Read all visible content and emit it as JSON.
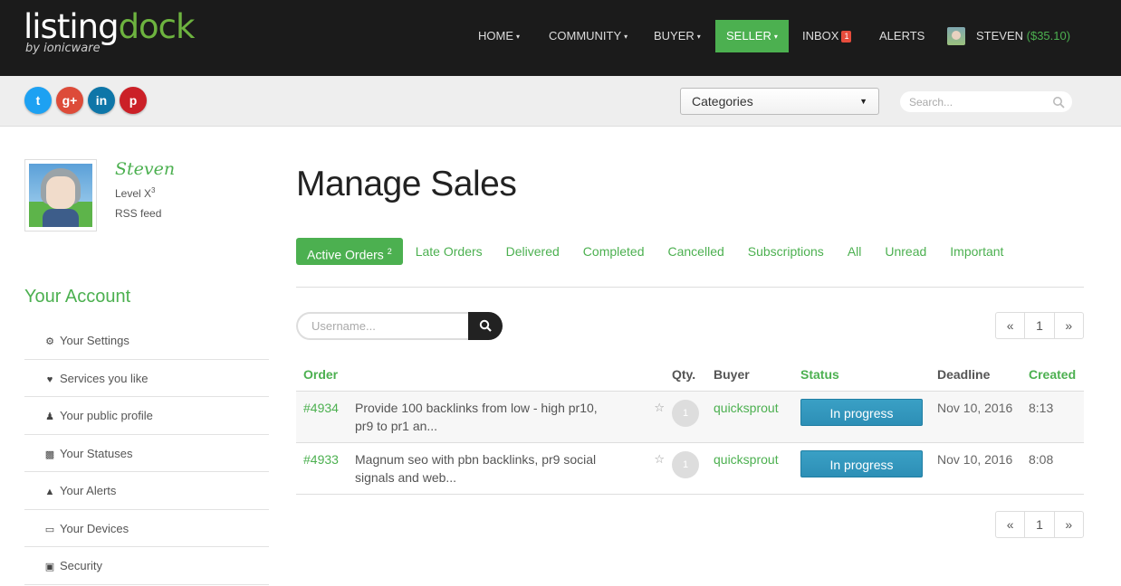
{
  "header": {
    "logo_main": "listing",
    "logo_accent": "dock",
    "logo_sub": "by ionicware",
    "nav": [
      {
        "label": "HOME",
        "caret": "▾"
      },
      {
        "label": "COMMUNITY",
        "caret": "▾"
      },
      {
        "label": "BUYER",
        "caret": "▾"
      },
      {
        "label": "SELLER",
        "caret": "▾"
      },
      {
        "label": "INBOX",
        "badge": "1"
      },
      {
        "label": "ALERTS"
      }
    ],
    "user": {
      "name": "STEVEN",
      "balance": "($35.10)"
    }
  },
  "secondary": {
    "social": {
      "twitter": "t",
      "google": "g+",
      "linkedin": "in",
      "pinterest": "p"
    },
    "categories_label": "Categories",
    "search_placeholder": "Search..."
  },
  "sidebar": {
    "username": "Steven",
    "level_text": "Level X",
    "level_sup": "3",
    "rss": "RSS feed",
    "account_title": "Your Account",
    "menu": [
      {
        "label": "Your Settings",
        "icon": "gears-icon"
      },
      {
        "label": "Services you like",
        "icon": "heart-icon"
      },
      {
        "label": "Your public profile",
        "icon": "user-icon"
      },
      {
        "label": "Your Statuses",
        "icon": "chart-icon"
      },
      {
        "label": "Your Alerts",
        "icon": "bell-icon"
      },
      {
        "label": "Your Devices",
        "icon": "monitor-icon"
      },
      {
        "label": "Security",
        "icon": "lock-icon"
      }
    ]
  },
  "main": {
    "title": "Manage Sales",
    "tabs": [
      {
        "label": "Active Orders",
        "count": "2"
      },
      {
        "label": "Late Orders"
      },
      {
        "label": "Delivered"
      },
      {
        "label": "Completed"
      },
      {
        "label": "Cancelled"
      },
      {
        "label": "Subscriptions"
      },
      {
        "label": "All"
      },
      {
        "label": "Unread"
      },
      {
        "label": "Important"
      }
    ],
    "filter_placeholder": "Username...",
    "pager": {
      "prev": "«",
      "page": "1",
      "next": "»"
    },
    "columns": {
      "order": "Order",
      "qty": "Qty.",
      "buyer": "Buyer",
      "status": "Status",
      "deadline": "Deadline",
      "created": "Created"
    },
    "orders": [
      {
        "id": "#4934",
        "desc_line1": "Provide 100 backlinks from low - high pr10,",
        "desc_line2": "pr9 to pr1 an...",
        "qty": "1",
        "buyer": "quicksprout",
        "status": "In progress",
        "deadline": "Nov 10, 2016",
        "created": "8:13"
      },
      {
        "id": "#4933",
        "desc_line1": "Magnum seo with pbn backlinks, pr9 social",
        "desc_line2": "signals and web...",
        "qty": "1",
        "buyer": "quicksprout",
        "status": "In progress",
        "deadline": "Nov 10, 2016",
        "created": "8:08"
      }
    ]
  }
}
